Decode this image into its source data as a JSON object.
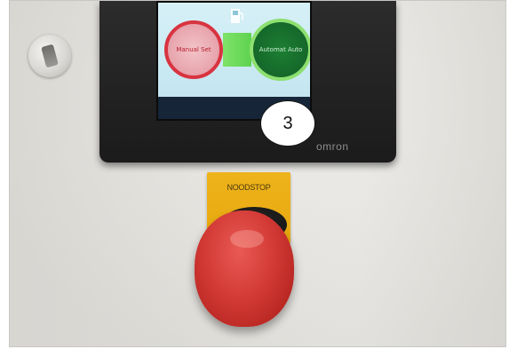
{
  "hmi": {
    "red_button_label": "Manual\nSet",
    "green_button_label": "Automat\nAuto",
    "brand": "omron"
  },
  "callout": {
    "number": "3"
  },
  "estop": {
    "label": "NOODSTOP"
  },
  "icons": {
    "tools": "tools-icon",
    "fuel": "fuel-pump-icon",
    "key": "key-switch-icon"
  },
  "colors": {
    "estop_red": "#d33a35",
    "estop_plate_yellow": "#eeb21a",
    "hmi_red_ring": "#d93340",
    "hmi_green_ring": "#8de070"
  }
}
